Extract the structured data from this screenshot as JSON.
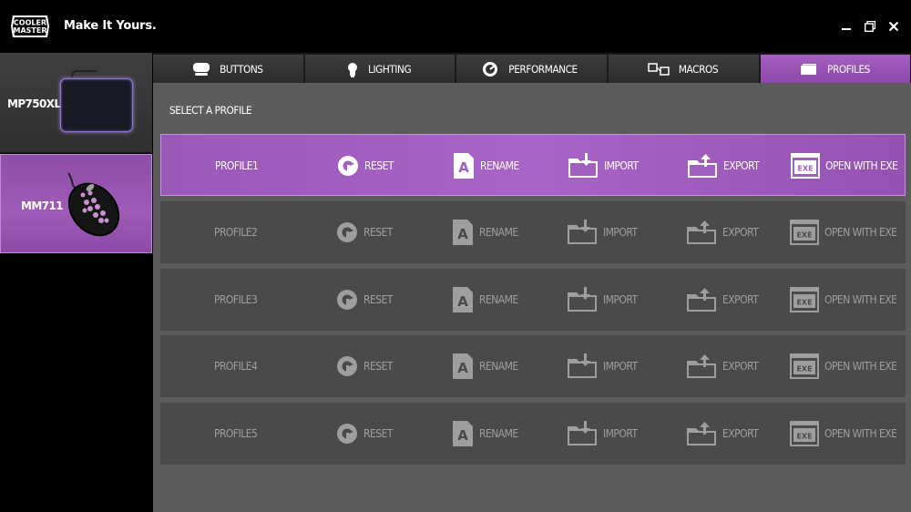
{
  "window": {
    "tagline": "Make It Yours.",
    "logo_text": [
      "COOLER",
      "MASTER"
    ]
  },
  "devices": [
    {
      "label": "MP750XL",
      "selected": false
    },
    {
      "label": "MM711",
      "selected": true
    }
  ],
  "tabs": [
    {
      "label": "BUTTONS",
      "icon": "mouse-top-icon",
      "active": false
    },
    {
      "label": "LIGHTING",
      "icon": "bulb-icon",
      "active": false
    },
    {
      "label": "PERFORMANCE",
      "icon": "gauge-icon",
      "active": false
    },
    {
      "label": "MACROS",
      "icon": "macro-icon",
      "active": false
    },
    {
      "label": "PROFILES",
      "icon": "profiles-icon",
      "active": true
    }
  ],
  "section_title": "SELECT A PROFILE",
  "actions": {
    "reset": "RESET",
    "rename": "RENAME",
    "import": "IMPORT",
    "export": "EXPORT",
    "open_exe": "OPEN WITH EXE",
    "exe_badge": "EXE"
  },
  "profiles": [
    {
      "name": "PROFILE1",
      "active": true
    },
    {
      "name": "PROFILE2",
      "active": false
    },
    {
      "name": "PROFILE3",
      "active": false
    },
    {
      "name": "PROFILE4",
      "active": false
    },
    {
      "name": "PROFILE5",
      "active": false
    }
  ],
  "colors": {
    "accent": "#9a58b8",
    "panel": "#5c5c5c",
    "row": "#4a4a4a",
    "inactive_text": "#9e9e9e"
  }
}
